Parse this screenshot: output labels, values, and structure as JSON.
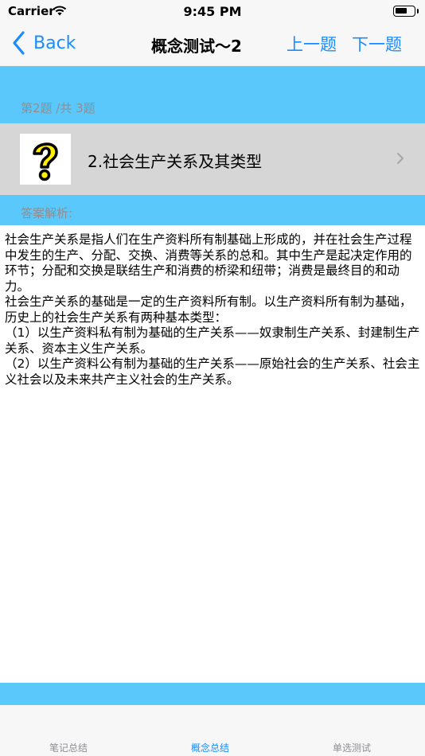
{
  "status": {
    "carrier": "Carrier",
    "time": "9:45 PM"
  },
  "nav": {
    "back_label": "Back",
    "title": "概念测试～2",
    "prev_label": "上一题",
    "next_label": "下一题"
  },
  "question": {
    "progress": "第2题 /共 3题",
    "title": "2.社会生产关系及其类型",
    "icon": "question-mark-icon"
  },
  "answer": {
    "label": "答案解析:",
    "text": "社会生产关系是指人们在生产资料所有制基础上形成的，并在社会生产过程中发生的生产、分配、交换、消费等关系的总和。其中生产是起决定作用的环节；分配和交换是联结生产和消费的桥梁和纽带；消费是最终目的和动力。\n社会生产关系的基础是一定的生产资料所有制。以生产资料所有制为基础，历史上的社会生产关系有两种基本类型：\n（1）以生产资料私有制为基础的生产关系——奴隶制生产关系、封建制生产关系、资本主义生产关系。\n（2）以生产资料公有制为基础的生产关系——原始社会的生产关系、社会主义社会以及未来共产主义社会的生产关系。"
  },
  "tabs": [
    {
      "label": "笔记总结"
    },
    {
      "label": "概念总结"
    },
    {
      "label": "单选测试"
    }
  ],
  "colors": {
    "accent": "#1a8cff",
    "header_blue": "#5ac8fa",
    "question_bg": "#d6d6d6",
    "icon_yellow": "#ffee00"
  }
}
